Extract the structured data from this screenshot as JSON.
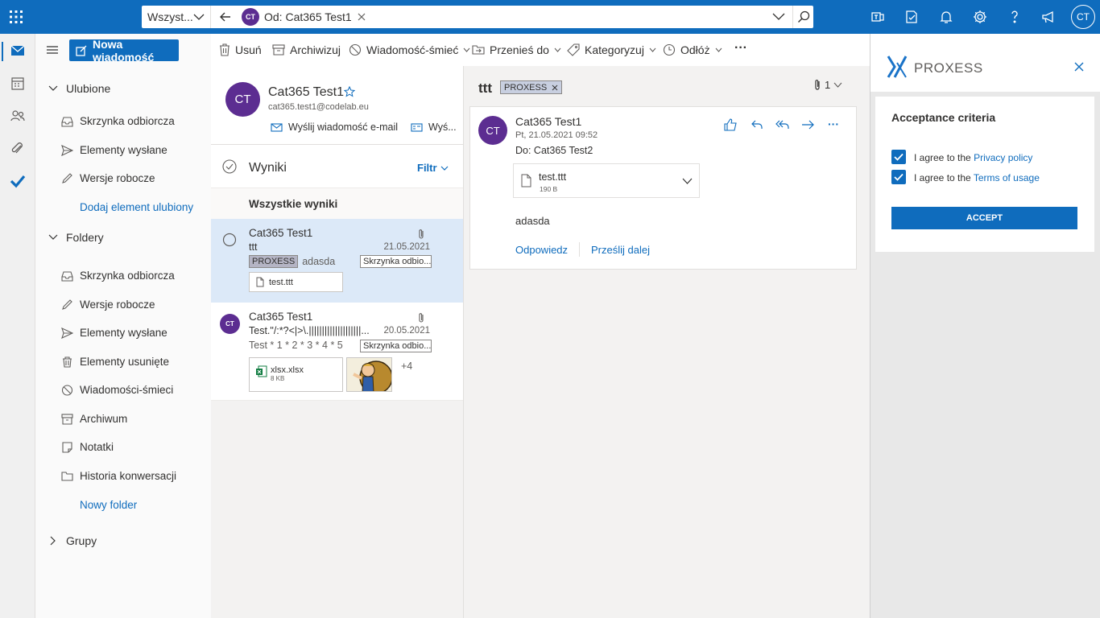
{
  "topbar": {
    "search_scope": "Wszyst...",
    "search_chip_avatar": "CT",
    "search_chip_label": "Od: Cat365 Test1",
    "user_initials": "CT",
    "accent_color": "#0f6cbd"
  },
  "folder_pane": {
    "new_message_label": "Nowa wiadomość",
    "favorites_header": "Ulubione",
    "favorites": [
      "Skrzynka odbiorcza",
      "Elementy wysłane",
      "Wersje robocze"
    ],
    "add_favorite_label": "Dodaj element ulubiony",
    "folders_header": "Foldery",
    "folders": [
      "Skrzynka odbiorcza",
      "Wersje robocze",
      "Elementy wysłane",
      "Elementy usunięte",
      "Wiadomości-śmieci",
      "Archiwum",
      "Notatki",
      "Historia konwersacji"
    ],
    "new_folder_label": "Nowy folder",
    "groups_header": "Grupy"
  },
  "command_bar": {
    "delete": "Usuń",
    "archive": "Archiwizuj",
    "junk": "Wiadomość-śmieć",
    "move": "Przenieś do",
    "categorize": "Kategoryzuj",
    "snooze": "Odłóż",
    "more": "···"
  },
  "message_list": {
    "contact": {
      "initials": "CT",
      "name": "Cat365 Test1",
      "email": "cat365.test1@codelab.eu",
      "send_email_label": "Wyślij wiadomość e-mail",
      "second_action_label": "Wyś..."
    },
    "results_label": "Wyniki",
    "filter_label": "Filtr",
    "all_results_label": "Wszystkie wyniki",
    "items": [
      {
        "sender": "Cat365 Test1",
        "subject": "ttt",
        "date": "21.05.2021",
        "tag": "PROXESS",
        "preview": "adasda",
        "folder": "Skrzynka odbio...",
        "attachment": "test.ttt"
      },
      {
        "avatar": "CT",
        "sender": "Cat365 Test1",
        "subject": "Test.\"/:*?<|>\\.||||||||||||||||||||...",
        "date": "20.05.2021",
        "preview": "Test * 1 * 2 * 3 * 4 * 5",
        "folder": "Skrzynka odbio...",
        "attachment_name": "xlsx.xlsx",
        "attachment_size": "8 KB",
        "more_count": "+4"
      }
    ]
  },
  "reading_pane": {
    "subject": "ttt",
    "tag": "PROXESS",
    "attachment_count": "1",
    "sender_initials": "CT",
    "sender": "Cat365 Test1",
    "datetime": "Pt, 21.05.2021 09:52",
    "to": "Do: Cat365 Test2",
    "attachment_name": "test.ttt",
    "attachment_size": "190 B",
    "body": "adasda",
    "reply_label": "Odpowiedz",
    "forward_label": "Prześlij dalej"
  },
  "addin": {
    "brand": "PROXESS",
    "section_title": "Acceptance criteria",
    "checkbox1_prefix": "I agree to the",
    "checkbox1_link": "Privacy policy",
    "checkbox2_prefix": "I agree to the",
    "checkbox2_link": "Terms of usage",
    "accept_label": "ACCEPT"
  }
}
